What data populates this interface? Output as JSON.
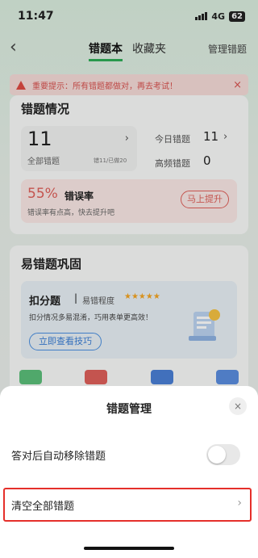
{
  "status_bar": {
    "time": "11:47",
    "network": "4G",
    "battery": "62"
  },
  "nav": {
    "back_icon": "chevron-left-icon",
    "tab_active": "错题本",
    "tab_other": "收藏夹",
    "manage": "管理错题"
  },
  "notice": {
    "text": "重要提示：所有错题都做对，再去考试！",
    "close": "×"
  },
  "stats": {
    "title": "错题情况",
    "all_count": "11",
    "all_label": "全部错题",
    "all_sub": "错11/已做20",
    "today_label": "今日错题",
    "today_count": "11",
    "freq_label": "高频错题",
    "freq_count": "0",
    "error_rate": "55%",
    "error_rate_label": "错误率",
    "error_tip": "错误率有点高，快去提升吧",
    "boost_button": "马上提升"
  },
  "consolidate": {
    "title": "易错题巩固",
    "tip_title": "扣分题",
    "sep": "|",
    "level_label": "易错程度",
    "stars": "★★★★★",
    "desc": "扣分情况多易混淆，巧用表单更高效！",
    "button": "立即查看技巧"
  },
  "sheet": {
    "title": "错题管理",
    "close": "×",
    "auto_remove": "答对后自动移除错题",
    "auto_remove_on": false,
    "clear_all": "清空全部错题",
    "chevron": "›"
  },
  "colors": {
    "accent": "#2fae57",
    "danger": "#e52f2a",
    "error_rate": "#e0605a",
    "link": "#3b7fd6"
  }
}
